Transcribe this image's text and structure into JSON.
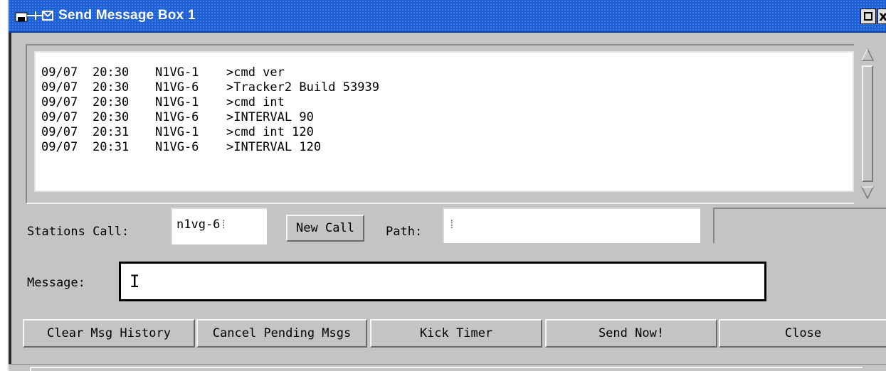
{
  "window": {
    "title": "Send Message Box 1",
    "controls": {
      "maximize_icon": "maximize-icon",
      "close_glyph": "x"
    }
  },
  "log": {
    "lines": [
      {
        "date": "09/07",
        "time": "20:30",
        "call": "N1VG-1",
        "text": ">cmd ver"
      },
      {
        "date": "09/07",
        "time": "20:30",
        "call": "N1VG-6",
        "text": ">Tracker2 Build 53939"
      },
      {
        "date": "09/07",
        "time": "20:30",
        "call": "N1VG-1",
        "text": ">cmd int"
      },
      {
        "date": "09/07",
        "time": "20:30",
        "call": "N1VG-6",
        "text": ">INTERVAL 90"
      },
      {
        "date": "09/07",
        "time": "20:31",
        "call": "N1VG-1",
        "text": ">cmd int 120"
      },
      {
        "date": "09/07",
        "time": "20:31",
        "call": "N1VG-6",
        "text": ">INTERVAL 120"
      }
    ]
  },
  "form": {
    "stations_call_label": "Stations Call:",
    "stations_call_value": "n1vg-6",
    "new_call_label": "New Call",
    "path_label": "Path:",
    "path_value": "",
    "status_value": "",
    "message_label": "Message:",
    "message_value": "I"
  },
  "buttons": {
    "clear_history": "Clear Msg History",
    "cancel_pending": "Cancel Pending Msgs",
    "kick_timer": "Kick Timer",
    "send_now": "Send Now!",
    "close": "Close"
  },
  "colors": {
    "title_bar": "#1e5fd2",
    "window_bg": "#c4c4c4"
  }
}
